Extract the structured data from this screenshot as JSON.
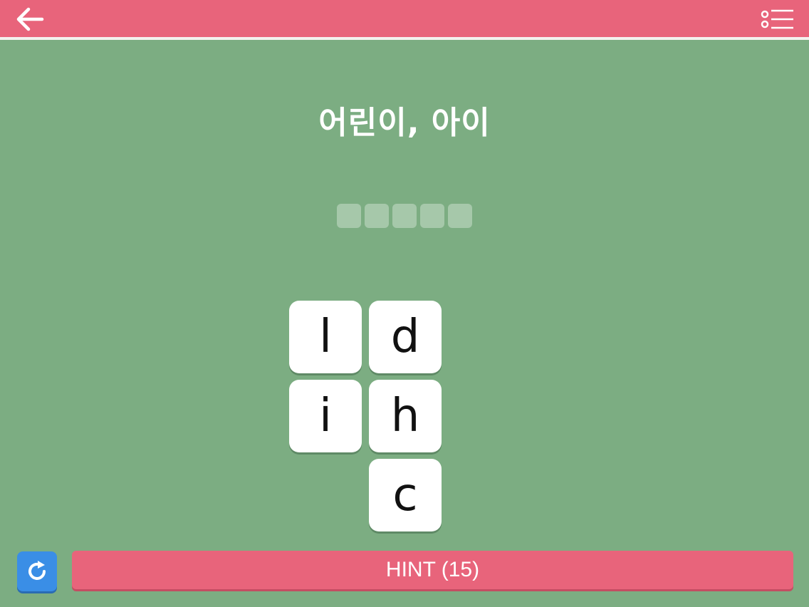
{
  "header": {
    "back_icon": "arrow-left-icon",
    "menu_icon": "list-menu-icon"
  },
  "puzzle": {
    "clue": "어린이, 아이",
    "answer_slots": 5
  },
  "tiles": [
    {
      "letter": "l"
    },
    {
      "letter": "d"
    },
    {
      "letter": "i"
    },
    {
      "letter": "h"
    },
    {
      "letter": "c"
    }
  ],
  "footer": {
    "refresh_icon": "refresh-icon",
    "hint_label": "HINT (15)"
  },
  "colors": {
    "background": "#7cad82",
    "header": "#e8647b",
    "hint_button": "#e8647b",
    "refresh_button": "#3a8ee6",
    "tile": "#ffffff",
    "slot": "#a6c8aa"
  }
}
